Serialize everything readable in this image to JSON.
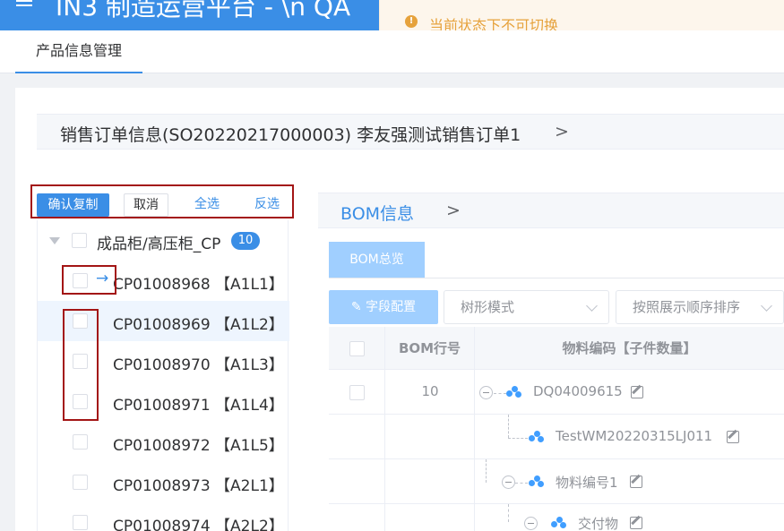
{
  "header": {
    "title": "IN3 制造运营平台 - \\n QA"
  },
  "toast": {
    "message": "当前状态下不可切换",
    "icon": "warning-icon"
  },
  "tabs": [
    {
      "label": "产品信息管理"
    }
  ],
  "order": {
    "title": "销售订单信息(SO20220217000003) 李友强测试销售订单1",
    "chevron": ">"
  },
  "actions": {
    "confirm_copy": "确认复制",
    "cancel": "取消",
    "select_all": "全选",
    "invert": "反选"
  },
  "tree": {
    "root": {
      "label": "成品柜/高压柜_CP",
      "count": "10"
    },
    "items": [
      {
        "label": "CP01008968 【A1L1】"
      },
      {
        "label": "CP01008969 【A1L2】"
      },
      {
        "label": "CP01008970 【A1L3】"
      },
      {
        "label": "CP01008971 【A1L4】"
      },
      {
        "label": "CP01008972 【A1L5】"
      },
      {
        "label": "CP01008973 【A2L1】"
      },
      {
        "label": "CP01008974 【A2L2】"
      }
    ]
  },
  "bom": {
    "title": "BOM信息",
    "chevron": ">",
    "tab": "BOM总览",
    "field_config": "字段配置",
    "mode_select": "树形模式",
    "sort_select": "按照展示顺序排序",
    "columns": {
      "line_no": "BOM行号",
      "material": "物料编码【子件数量】"
    },
    "rows": [
      {
        "line_no": "10",
        "material": "DQ04009615"
      },
      {
        "line_no": "",
        "material": "TestWM20220315LJ011"
      },
      {
        "line_no": "",
        "material": "物料编号1"
      },
      {
        "line_no": "",
        "material": "交付物"
      }
    ]
  },
  "colors": {
    "primary": "#3a8ee6",
    "warning": "#e6a23c",
    "annotation": "#a31515"
  }
}
